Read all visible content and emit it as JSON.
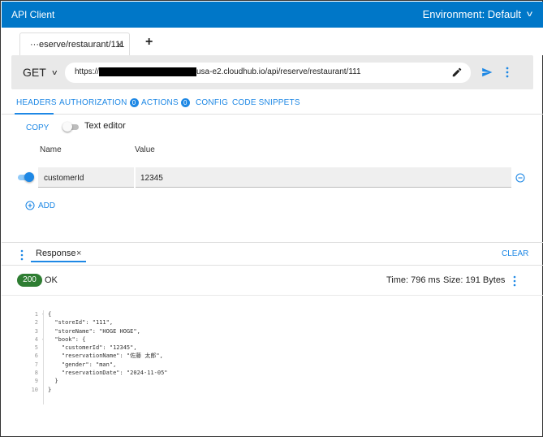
{
  "app": {
    "title": "API Client"
  },
  "environment": {
    "label": "Environment: Default"
  },
  "tabs": [
    {
      "label": "···eserve/restaurant/111",
      "close": "×"
    }
  ],
  "add_tab": "+",
  "request": {
    "method": "GET",
    "url_prefix": "https://",
    "url_suffix": "usa-e2.cloudhub.io/api/reserve/restaurant/111"
  },
  "subtabs": [
    {
      "label": "HEADERS",
      "active": true
    },
    {
      "label": "AUTHORIZATION",
      "badge": "0"
    },
    {
      "label": "ACTIONS",
      "badge": "0"
    },
    {
      "label": "CONFIG"
    },
    {
      "label": "CODE SNIPPETS"
    }
  ],
  "headers_editor": {
    "copy_label": "COPY",
    "text_editor_label": "Text editor",
    "col_name": "Name",
    "col_value": "Value",
    "rows": [
      {
        "name": "customerId",
        "value": "12345",
        "enabled": true
      }
    ],
    "add_label": "ADD"
  },
  "response": {
    "tab_label": "Response",
    "tab_close": "×",
    "clear_label": "CLEAR",
    "status_code": "200",
    "status_text": "OK",
    "time": "Time: 796 ms",
    "size": "Size: 191 Bytes",
    "body_lines": [
      {
        "n": "1",
        "fold": "-",
        "text": "{"
      },
      {
        "n": "2",
        "fold": "",
        "text": "  \"storeId\": \"111\","
      },
      {
        "n": "3",
        "fold": "",
        "text": "  \"storeName\": \"HOGE HOGE\","
      },
      {
        "n": "4",
        "fold": "-",
        "text": "  \"book\": {"
      },
      {
        "n": "5",
        "fold": "",
        "text": "    \"customerId\": \"12345\","
      },
      {
        "n": "6",
        "fold": "",
        "text": "    \"reservationName\": \"佐藤 太郎\","
      },
      {
        "n": "7",
        "fold": "",
        "text": "    \"gender\": \"man\","
      },
      {
        "n": "8",
        "fold": "",
        "text": "    \"reservationDate\": \"2024-11-05\""
      },
      {
        "n": "9",
        "fold": "",
        "text": "  }"
      },
      {
        "n": "10",
        "fold": "",
        "text": "}"
      }
    ]
  },
  "colors": {
    "accent": "#1e88e5",
    "titlebar": "#0077c8",
    "status_ok": "#2e7d32"
  },
  "icons": {
    "send": "send-icon",
    "edit": "pencil-icon",
    "more": "more-vert-icon",
    "remove": "remove-circle-icon",
    "add": "add-circle-icon",
    "menu": "more-vert-icon"
  }
}
